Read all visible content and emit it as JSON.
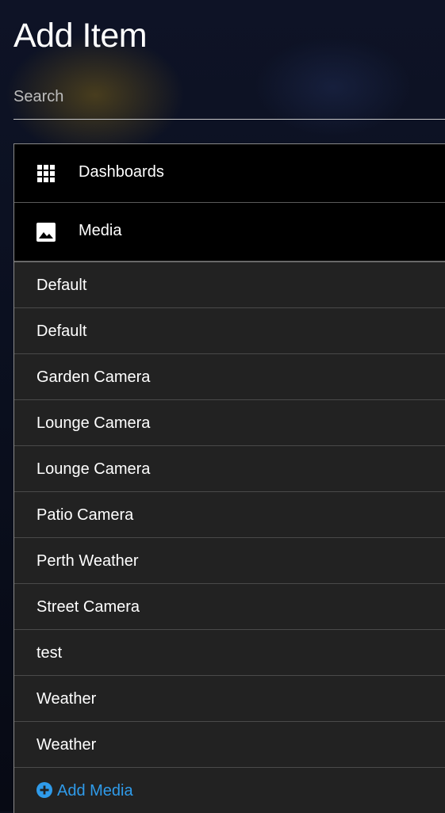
{
  "header": {
    "title": "Add Item"
  },
  "search": {
    "placeholder": "Search",
    "value": ""
  },
  "categories": [
    {
      "label": "Dashboards",
      "icon": "grid-icon"
    },
    {
      "label": "Media",
      "icon": "image-icon"
    }
  ],
  "media_items": [
    "Default",
    "Default",
    "Garden Camera",
    "Lounge Camera",
    "Lounge Camera",
    "Patio Camera",
    "Perth Weather",
    "Street Camera",
    "test",
    "Weather",
    "Weather"
  ],
  "add_media": {
    "label": "Add Media",
    "icon": "plus-circle-icon",
    "color": "#2f9bea"
  },
  "colors": {
    "category_bg": "#000000",
    "list_bg": "#222222",
    "accent": "#2f9bea"
  }
}
